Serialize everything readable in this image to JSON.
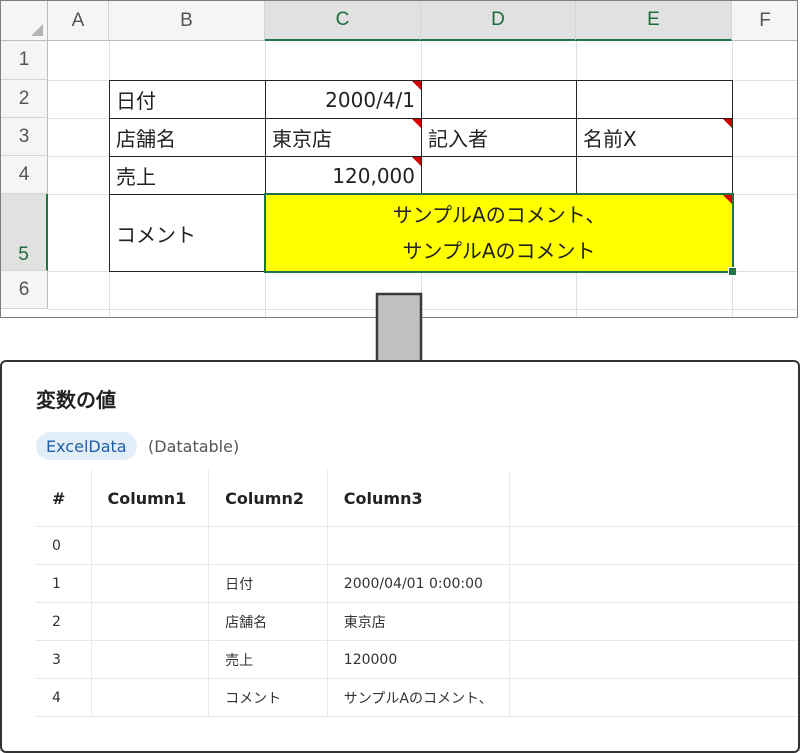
{
  "excel": {
    "columns": [
      "A",
      "B",
      "C",
      "D",
      "E",
      "F"
    ],
    "rows": [
      "1",
      "2",
      "3",
      "4",
      "5",
      "6"
    ],
    "cells": {
      "b2": "日付",
      "c2": "2000/4/1",
      "b3": "店舗名",
      "c3": "東京店",
      "d3": "記入者",
      "e3": "名前X",
      "b4": "売上",
      "c4": "120,000",
      "b5": "コメント",
      "c5_line1": "サンプルAのコメント、",
      "c5_line2": "サンプルAのコメント"
    },
    "highlight_color": "#ffff00",
    "selection_color": "#217346",
    "comment_marker_color": "#d00000"
  },
  "arrow": {
    "icon": "down-arrow-icon",
    "color": "#c0c0c0"
  },
  "panel": {
    "title": "変数の値",
    "variable_name": "ExcelData",
    "variable_type": "(Datatable)",
    "table": {
      "headers": [
        "#",
        "Column1",
        "Column2",
        "Column3",
        ""
      ],
      "rows": [
        [
          "0",
          "",
          "",
          "",
          ""
        ],
        [
          "1",
          "",
          "日付",
          "2000/04/01 0:00:00",
          ""
        ],
        [
          "2",
          "",
          "店舗名",
          "東京店",
          ""
        ],
        [
          "3",
          "",
          "売上",
          "120000",
          ""
        ],
        [
          "4",
          "",
          "コメント",
          "サンプルAのコメント、",
          ""
        ]
      ]
    }
  }
}
